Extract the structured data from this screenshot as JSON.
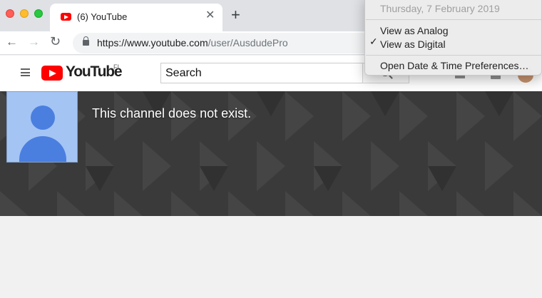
{
  "browser": {
    "tab": {
      "title": "(6) YouTube",
      "close_glyph": "✕",
      "favicon": "youtube-favicon"
    },
    "new_tab_glyph": "+",
    "nav": {
      "back_glyph": "←",
      "forward_glyph": "→",
      "reload_glyph": "↻"
    },
    "address": {
      "host": "https://www.youtube.com",
      "path": "/user/AusdudePro"
    }
  },
  "youtube": {
    "logo_text": "YouTube",
    "country_code": "FI",
    "search_placeholder": "Search",
    "brand_color": "#ff0000"
  },
  "channel": {
    "message": "This channel does not exist.",
    "avatar_color": "#a4c4f4"
  },
  "clock_menu": {
    "date": "Thursday, 7 February 2019",
    "items": [
      {
        "label": "View as Analog",
        "checked": false
      },
      {
        "label": "View as Digital",
        "checked": true
      },
      {
        "label": "Open Date & Time Preferences…",
        "checked": false
      }
    ],
    "check_glyph": "✓"
  }
}
